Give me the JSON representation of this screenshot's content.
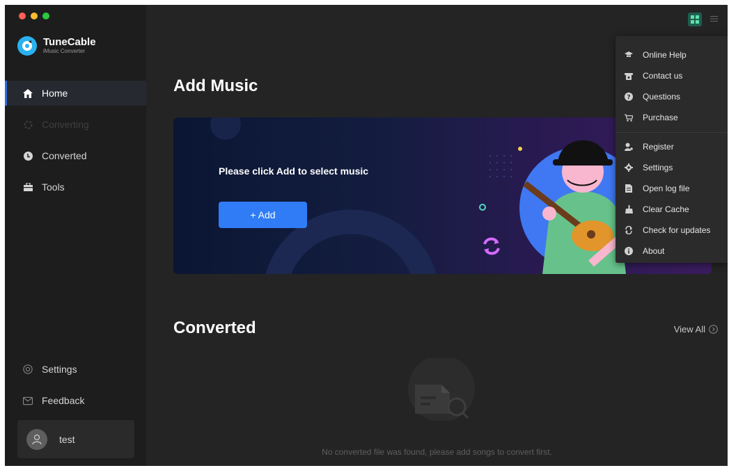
{
  "app": {
    "name": "TuneCable",
    "subtitle": "iMusic Converter"
  },
  "sidebar": {
    "items": [
      {
        "label": "Home",
        "icon": "home-icon"
      },
      {
        "label": "Converting",
        "icon": "spinner-icon"
      },
      {
        "label": "Converted",
        "icon": "clock-icon"
      },
      {
        "label": "Tools",
        "icon": "toolbox-icon"
      }
    ],
    "bottom": [
      {
        "label": "Settings",
        "icon": "gear-icon"
      },
      {
        "label": "Feedback",
        "icon": "mail-icon"
      }
    ],
    "user": {
      "name": "test"
    }
  },
  "main": {
    "add_section": {
      "title": "Add Music",
      "prompt": "Please click Add to select music",
      "add_button": "+ Add"
    },
    "converted_section": {
      "title": "Converted",
      "view_all": "View All",
      "empty_message": "No converted file was found, please add songs to convert first."
    }
  },
  "menu": {
    "items": [
      {
        "label": "Online Help",
        "icon": "graduation-cap-icon"
      },
      {
        "label": "Contact us",
        "icon": "phone-icon"
      },
      {
        "label": "Questions",
        "icon": "question-icon"
      },
      {
        "label": "Purchase",
        "icon": "cart-icon"
      },
      {
        "label": "Register",
        "icon": "user-key-icon"
      },
      {
        "label": "Settings",
        "icon": "gear-icon"
      },
      {
        "label": "Open log file",
        "icon": "file-icon"
      },
      {
        "label": "Clear Cache",
        "icon": "broom-icon"
      },
      {
        "label": "Check for updates",
        "icon": "refresh-icon"
      },
      {
        "label": "About",
        "icon": "info-icon"
      }
    ]
  },
  "colors": {
    "accent": "#2f7cf6",
    "sidebar_bg": "#1d1d1d",
    "main_bg": "#242424",
    "menu_bg": "#2b2b2b"
  }
}
